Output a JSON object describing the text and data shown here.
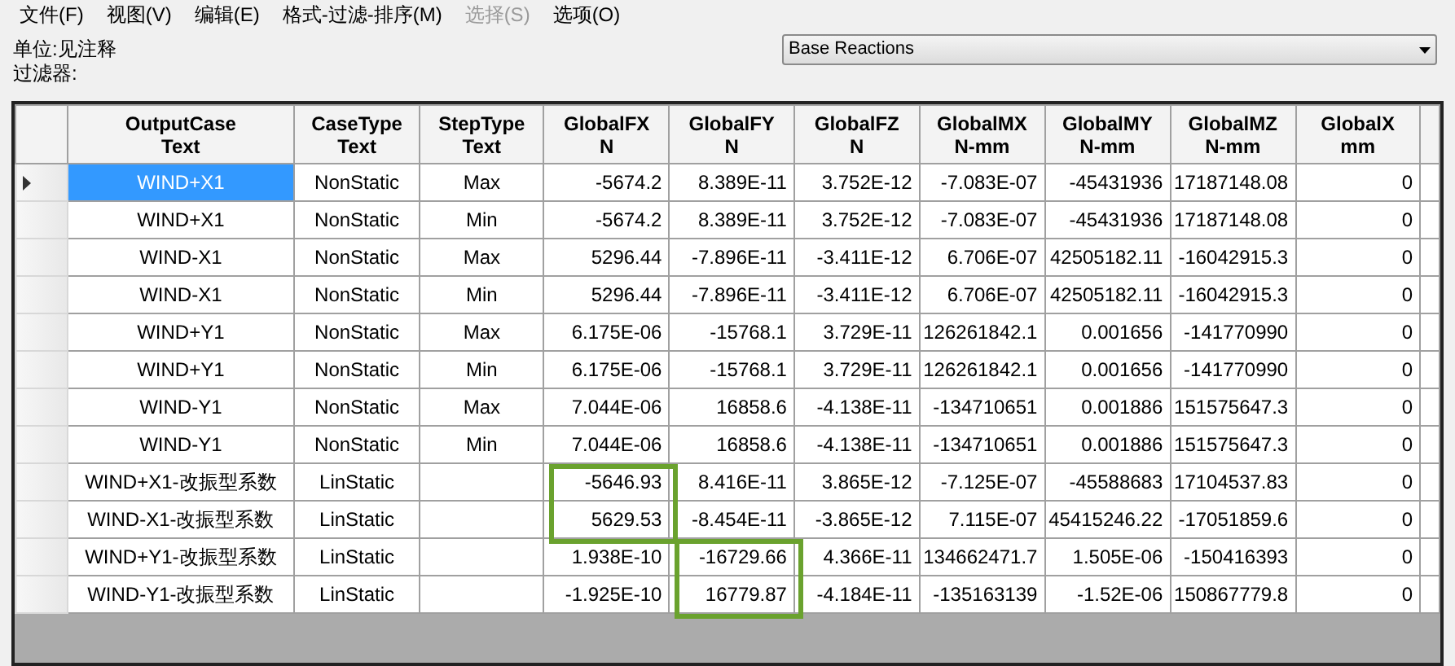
{
  "menu": [
    {
      "label": "文件(F)",
      "disabled": false
    },
    {
      "label": "视图(V)",
      "disabled": false
    },
    {
      "label": "编辑(E)",
      "disabled": false
    },
    {
      "label": "格式-过滤-排序(M)",
      "disabled": false
    },
    {
      "label": "选择(S)",
      "disabled": true
    },
    {
      "label": "选项(O)",
      "disabled": false
    }
  ],
  "units_label": "单位:见注释",
  "filter_label": "过滤器:",
  "table_select": {
    "value": "Base Reactions"
  },
  "columns": [
    {
      "name": "OutputCase",
      "unit": "Text",
      "kind": "text"
    },
    {
      "name": "CaseType",
      "unit": "Text",
      "kind": "text"
    },
    {
      "name": "StepType",
      "unit": "Text",
      "kind": "text"
    },
    {
      "name": "GlobalFX",
      "unit": "N",
      "kind": "number"
    },
    {
      "name": "GlobalFY",
      "unit": "N",
      "kind": "number"
    },
    {
      "name": "GlobalFZ",
      "unit": "N",
      "kind": "number"
    },
    {
      "name": "GlobalMX",
      "unit": "N-mm",
      "kind": "number"
    },
    {
      "name": "GlobalMY",
      "unit": "N-mm",
      "kind": "number"
    },
    {
      "name": "GlobalMZ",
      "unit": "N-mm",
      "kind": "number"
    },
    {
      "name": "GlobalX",
      "unit": "mm",
      "kind": "number"
    }
  ],
  "rows": [
    {
      "selected": true,
      "cells": [
        "WIND+X1",
        "NonStatic",
        "Max",
        "-5674.2",
        "8.389E-11",
        "3.752E-12",
        "-7.083E-07",
        "-45431936",
        "17187148.08",
        "0"
      ]
    },
    {
      "selected": false,
      "cells": [
        "WIND+X1",
        "NonStatic",
        "Min",
        "-5674.2",
        "8.389E-11",
        "3.752E-12",
        "-7.083E-07",
        "-45431936",
        "17187148.08",
        "0"
      ]
    },
    {
      "selected": false,
      "cells": [
        "WIND-X1",
        "NonStatic",
        "Max",
        "5296.44",
        "-7.896E-11",
        "-3.411E-12",
        "6.706E-07",
        "42505182.11",
        "-16042915.3",
        "0"
      ]
    },
    {
      "selected": false,
      "cells": [
        "WIND-X1",
        "NonStatic",
        "Min",
        "5296.44",
        "-7.896E-11",
        "-3.411E-12",
        "6.706E-07",
        "42505182.11",
        "-16042915.3",
        "0"
      ]
    },
    {
      "selected": false,
      "cells": [
        "WIND+Y1",
        "NonStatic",
        "Max",
        "6.175E-06",
        "-15768.1",
        "3.729E-11",
        "126261842.1",
        "0.001656",
        "-141770990",
        "0"
      ]
    },
    {
      "selected": false,
      "cells": [
        "WIND+Y1",
        "NonStatic",
        "Min",
        "6.175E-06",
        "-15768.1",
        "3.729E-11",
        "126261842.1",
        "0.001656",
        "-141770990",
        "0"
      ]
    },
    {
      "selected": false,
      "cells": [
        "WIND-Y1",
        "NonStatic",
        "Max",
        "7.044E-06",
        "16858.6",
        "-4.138E-11",
        "-134710651",
        "0.001886",
        "151575647.3",
        "0"
      ]
    },
    {
      "selected": false,
      "cells": [
        "WIND-Y1",
        "NonStatic",
        "Min",
        "7.044E-06",
        "16858.6",
        "-4.138E-11",
        "-134710651",
        "0.001886",
        "151575647.3",
        "0"
      ]
    },
    {
      "selected": false,
      "cells": [
        "WIND+X1-改振型系数",
        "LinStatic",
        "",
        {
          "text": "-5646.93",
          "outlined": true
        },
        "8.416E-11",
        "3.865E-12",
        "-7.125E-07",
        "-45588683",
        "17104537.83",
        "0"
      ]
    },
    {
      "selected": false,
      "cells": [
        "WIND-X1-改振型系数",
        "LinStatic",
        "",
        {
          "text": "5629.53",
          "outlined": true
        },
        "-8.454E-11",
        "-3.865E-12",
        "7.115E-07",
        "45415246.22",
        "-17051859.6",
        "0"
      ]
    },
    {
      "selected": false,
      "cells": [
        "WIND+Y1-改振型系数",
        "LinStatic",
        "",
        "1.938E-10",
        {
          "text": "-16729.66",
          "outlined": true
        },
        "4.366E-11",
        "134662471.7",
        "1.505E-06",
        "-150416393",
        "0"
      ]
    },
    {
      "selected": false,
      "cells": [
        "WIND-Y1-改振型系数",
        "LinStatic",
        "",
        "-1.925E-10",
        {
          "text": "16779.87",
          "outlined": true
        },
        "-4.184E-11",
        "-135163139",
        "-1.52E-06",
        "150867779.8",
        "0"
      ]
    }
  ]
}
